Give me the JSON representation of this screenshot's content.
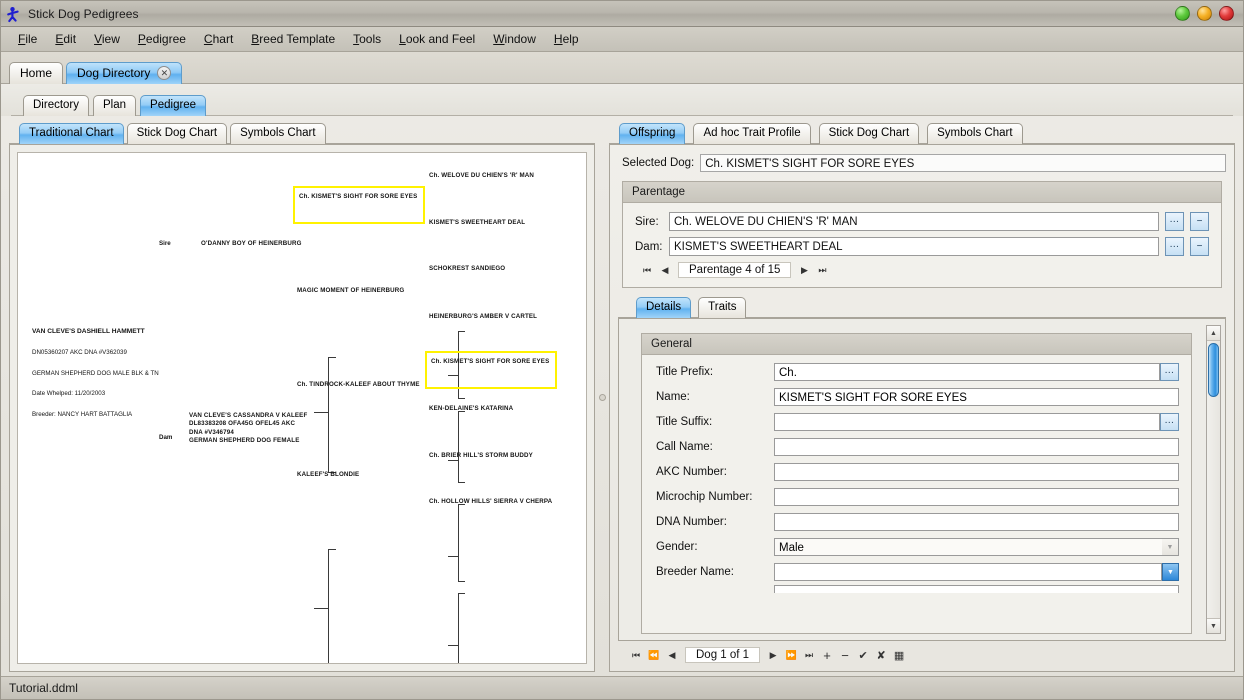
{
  "window": {
    "title": "Stick Dog Pedigrees",
    "icon": "stick-dog-icon",
    "buttons": {
      "minimize": "minimize",
      "maximize": "maximize",
      "close": "close"
    }
  },
  "menubar": {
    "items": [
      {
        "label": "File",
        "mnemonic": "F"
      },
      {
        "label": "Edit",
        "mnemonic": "E"
      },
      {
        "label": "View",
        "mnemonic": "V"
      },
      {
        "label": "Pedigree",
        "mnemonic": "P"
      },
      {
        "label": "Chart",
        "mnemonic": "C"
      },
      {
        "label": "Breed Template",
        "mnemonic": "B"
      },
      {
        "label": "Tools",
        "mnemonic": "T"
      },
      {
        "label": "Look and Feel",
        "mnemonic": "L"
      },
      {
        "label": "Window",
        "mnemonic": "W"
      },
      {
        "label": "Help",
        "mnemonic": "H"
      }
    ]
  },
  "document_tabs": {
    "items": [
      {
        "label": "Home",
        "selected": false,
        "closable": false
      },
      {
        "label": "Dog Directory",
        "selected": true,
        "closable": true,
        "close_glyph": "✕"
      }
    ]
  },
  "section_tabs": {
    "items": [
      {
        "label": "Directory",
        "selected": false
      },
      {
        "label": "Plan",
        "selected": false
      },
      {
        "label": "Pedigree",
        "selected": true
      }
    ]
  },
  "left_pane": {
    "chart_tabs": {
      "items": [
        {
          "label": "Traditional Chart",
          "selected": true
        },
        {
          "label": "Stick Dog Chart",
          "selected": false
        },
        {
          "label": "Symbols Chart",
          "selected": false
        }
      ]
    },
    "pedigree": {
      "subject": {
        "name": "VAN CLEVE'S DASHIELL HAMMETT",
        "registration": "DN05360207  AKC  DNA #V362039",
        "breed_line": "GERMAN SHEPHERD DOG MALE BLK & TN",
        "whelped": "Date  Whelped:  11/20/2003",
        "breeder": "Breeder: NANCY  HART  BATTAGLIA"
      },
      "sire_label": "Sire",
      "dam_label": "Dam",
      "gen1": {
        "sire": "O'DANNY BOY OF HEINERBURG",
        "dam": "VAN CLEVE'S CASSANDRA V KALEEF\nDL83383208 OFA45G OFEL45 AKC\nDNA #V346794\nGERMAN SHEPHERD DOG FEMALE"
      },
      "gen2": {
        "sire_sire": "Ch. KISMET'S SIGHT FOR SORE EYES",
        "sire_dam": "MAGIC MOMENT OF HEINERBURG",
        "dam_sire": "Ch. TINDROCK-KALEEF ABOUT THYME",
        "dam_dam": "KALEEF'S BLONDIE"
      },
      "gen3": {
        "a": "Ch. WELOVE DU CHIEN'S 'R' MAN",
        "b": "KISMET'S SWEETHEART DEAL",
        "c": "SCHOKREST SANDIEGO",
        "d": "HEINERBURG'S AMBER V CARTEL",
        "e": "Ch. KISMET'S SIGHT FOR SORE EYES",
        "f": "KEN-DELAINE'S KATARINA",
        "g": "Ch. BRIER HILL'S STORM BUDDY",
        "h": "Ch. HOLLOW HILLS' SIERRA V CHERPA"
      },
      "highlight_color": "#fff200"
    }
  },
  "right_pane": {
    "view_tabs": {
      "items": [
        {
          "label": "Offspring",
          "selected": true
        },
        {
          "label": "Ad hoc Trait Profile",
          "selected": false
        },
        {
          "label": "Stick Dog Chart",
          "selected": false
        },
        {
          "label": "Symbols Chart",
          "selected": false
        }
      ]
    },
    "selected_dog": {
      "label": "Selected Dog:",
      "value": "Ch. KISMET'S SIGHT FOR SORE EYES"
    },
    "parentage": {
      "title": "Parentage",
      "sire": {
        "label": "Sire:",
        "value": "Ch. WELOVE DU CHIEN'S 'R' MAN",
        "browse": "…",
        "remove": "−"
      },
      "dam": {
        "label": "Dam:",
        "value": "KISMET'S SWEETHEART DEAL",
        "browse": "…",
        "remove": "−"
      },
      "nav": {
        "first": "⏮",
        "prev": "◀",
        "label": "Parentage 4 of 15",
        "next": "▶",
        "last": "⏭"
      }
    },
    "detail_tabs": {
      "items": [
        {
          "label": "Details",
          "selected": true
        },
        {
          "label": "Traits",
          "selected": false
        }
      ]
    },
    "general": {
      "title": "General",
      "fields": [
        {
          "label": "Title Prefix:",
          "value": "Ch.",
          "control": "text-ellipsis"
        },
        {
          "label": "Name:",
          "value": "KISMET'S SIGHT FOR SORE EYES",
          "control": "text"
        },
        {
          "label": "Title Suffix:",
          "value": "",
          "control": "text-ellipsis"
        },
        {
          "label": "Call Name:",
          "value": "",
          "control": "text"
        },
        {
          "label": "AKC Number:",
          "value": "",
          "control": "text"
        },
        {
          "label": "Microchip Number:",
          "value": "",
          "control": "text"
        },
        {
          "label": "DNA Number:",
          "value": "",
          "control": "text"
        },
        {
          "label": "Gender:",
          "value": "Male",
          "control": "combo-disabled"
        },
        {
          "label": "Breeder Name:",
          "value": "",
          "control": "combo-active"
        }
      ],
      "ellipsis_glyph": "…",
      "arrow_glyph": "▼"
    },
    "record_nav": {
      "first": "⏮",
      "rewind": "⏪",
      "prev": "◀",
      "label": "Dog 1 of 1",
      "next": "▶",
      "fforward": "⏩",
      "last": "⏭",
      "add": "+",
      "remove": "−",
      "commit": "✔",
      "cancel": "✘",
      "grid": "▦"
    },
    "scrollbar": {
      "up": "▲",
      "down": "▼"
    }
  },
  "statusbar": {
    "text": "Tutorial.ddml"
  }
}
